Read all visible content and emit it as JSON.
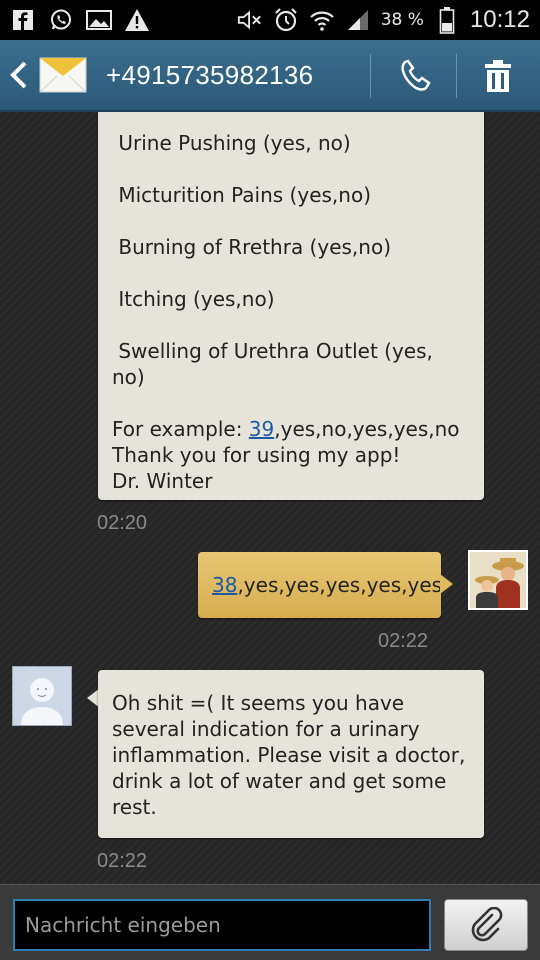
{
  "status_bar": {
    "battery_percent": "38 %",
    "time": "10:12"
  },
  "header": {
    "contact_number": "+4915735982136"
  },
  "messages": {
    "first": {
      "lines": [
        " Urine Pushing (yes, no)",
        " Micturition Pains (yes,no)",
        " Burning of Rrethra (yes,no)",
        " Itching (yes,no)",
        " Swelling of Urethra Outlet (yes,",
        "no)"
      ],
      "example_prefix": "For example: ",
      "example_link": "39",
      "example_rest": ",yes,no,yes,yes,no",
      "thanks": "Thank you for using my app!",
      "signature": "Dr. Winter",
      "time": "02:20"
    },
    "second": {
      "link": "38",
      "rest": ",yes,yes,yes,yes,yes",
      "time": "02:22"
    },
    "third": {
      "lines": [
        "Oh shit =( It seems you have",
        "several indication for a urinary",
        "inflammation. Please visit a doctor,",
        "drink a lot of water and get some",
        "rest."
      ],
      "time": "02:22"
    }
  },
  "input": {
    "placeholder": "Nachricht eingeben"
  },
  "icons": {
    "status_left": [
      "facebook-icon",
      "whatsapp-icon",
      "gallery-icon",
      "warning-icon"
    ],
    "status_right": [
      "mute-icon",
      "alarm-icon",
      "wifi-icon",
      "signal-icon",
      "battery-icon"
    ],
    "header": [
      "back-icon",
      "envelope-icon",
      "phone-icon",
      "trash-icon"
    ],
    "input": [
      "paperclip-icon"
    ]
  }
}
